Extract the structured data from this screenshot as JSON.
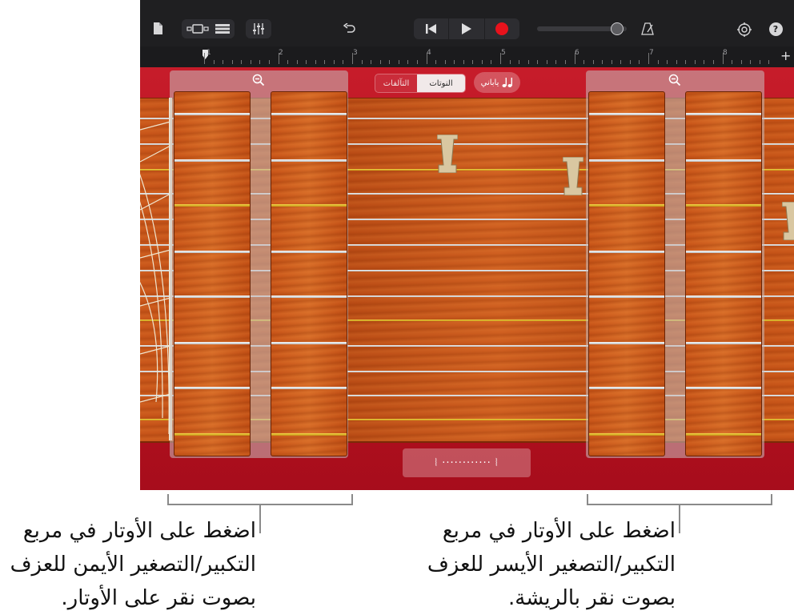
{
  "toolbar": {
    "icons": [
      "document-icon",
      "view-toggle-icon",
      "tracks-view-icon",
      "mixer-icon",
      "undo-icon",
      "rewind-icon",
      "play-icon",
      "record-icon",
      "volume-slider",
      "metronome-icon",
      "settings-icon",
      "help-icon"
    ],
    "record_color": "#e8121c",
    "volume_level": 0.8
  },
  "ruler": {
    "bars": [
      "1",
      "2",
      "3",
      "4",
      "5",
      "6",
      "7",
      "8"
    ],
    "add_label": "+"
  },
  "controls": {
    "segment": [
      "التآلفات",
      "النوتات"
    ],
    "selected_segment": "النوتات",
    "scale_label": "ياباني"
  },
  "instrument": {
    "slider_label": "⦚ ············ ⦚"
  },
  "callouts": {
    "left": [
      "اضغط على الأوتار في مربع",
      "التكبير/التصغير الأيمن للعزف",
      "بصوت نقر على الأوتار."
    ],
    "right": [
      "اضغط على الأوتار في مربع",
      "التكبير/التصغير الأيسر للعزف",
      "بصوت نقر بالريشة."
    ]
  },
  "colors": {
    "stage_red": "#c61c2a",
    "wood": "#c9561a",
    "gold_string": "#e5c030"
  }
}
